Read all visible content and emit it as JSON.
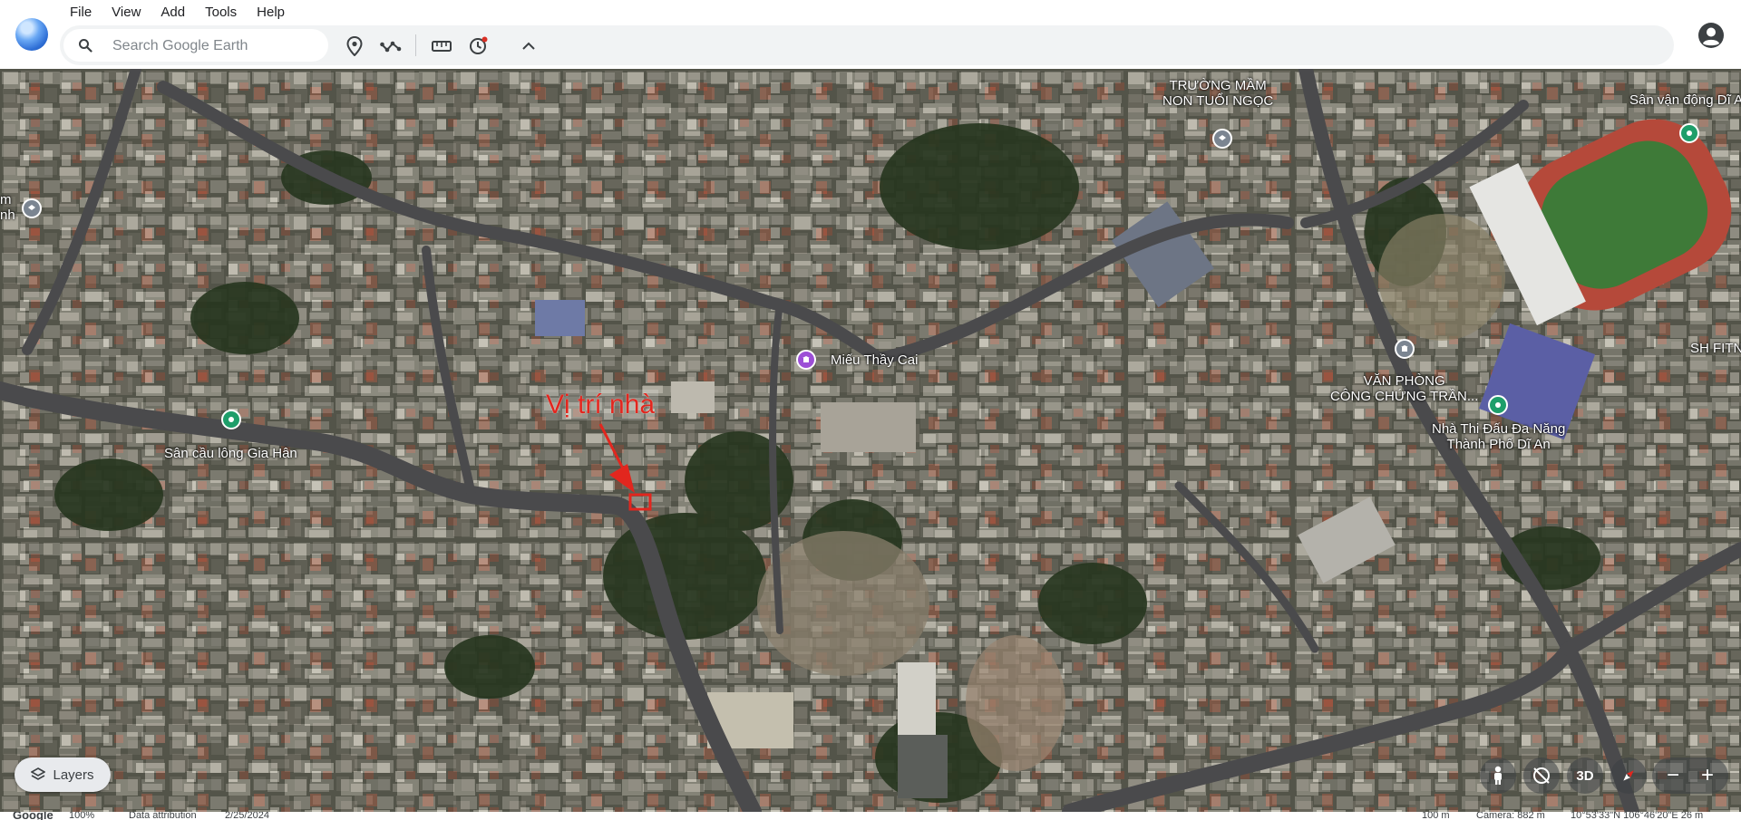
{
  "menu": [
    "File",
    "View",
    "Add",
    "Tools",
    "Help"
  ],
  "search": {
    "placeholder": "Search Google Earth"
  },
  "map": {
    "labels": {
      "school": [
        "TRƯỜNG MẦM",
        "NON TUỔI NGỌC"
      ],
      "stadium": "Sân vận động Dĩ A",
      "temple": "Miếu Thầy Cai",
      "office": [
        "VĂN PHÒNG",
        "CÔNG CHỨNG TRẦN..."
      ],
      "arena": [
        "Nhà Thi Đấu Đa Năng",
        "Thành Phố Dĩ An"
      ],
      "badminton": "Sân cầu lông Gia Hân",
      "fitness": "SH FITN",
      "left_edge": [
        "m",
        "nh"
      ]
    },
    "annotation": "Vị trí nhà"
  },
  "controls": {
    "layers_label": "Layers",
    "three_d_label": "3D",
    "zoom_out": "−",
    "zoom_in": "+"
  },
  "status": {
    "google": "Google",
    "zoom_pct": "100%",
    "attribution": "Data attribution",
    "date": "2/25/2024",
    "scale": "100 m",
    "camera": "Camera: 882 m",
    "coords": "10°53'33\"N 106°46'20\"E  26 m"
  },
  "colors": {
    "accent": "#1a73e8",
    "annotation": "#e2261e",
    "pin_green": "#1e9e6a",
    "pin_purple": "#9c4fd6",
    "pin_gray": "#7b8591"
  }
}
